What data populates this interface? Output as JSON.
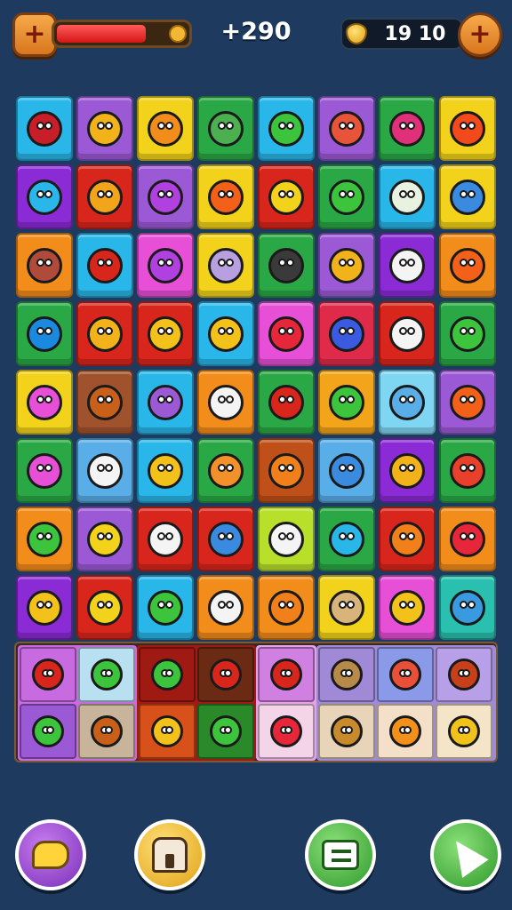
{
  "hud": {
    "health_fraction": 0.82,
    "score": "+290",
    "coins": "19 10",
    "icons": [
      "plus-icon",
      "coin-icon",
      "plus-icon"
    ]
  },
  "board": {
    "rows": 8,
    "cols": 8,
    "tile_colors": [
      [
        "#29b6e8",
        "#9b59d6",
        "#f2d21a",
        "#2aa845",
        "#29b6e8",
        "#9b59d6",
        "#2aa845",
        "#f2d21a"
      ],
      [
        "#8a2bd6",
        "#d8261c",
        "#9b59d6",
        "#f2d21a",
        "#d8261c",
        "#2aa845",
        "#29b6e8",
        "#f2d21a"
      ],
      [
        "#f28c1a",
        "#29b6e8",
        "#e64fd6",
        "#f2d21a",
        "#2aa845",
        "#9b59d6",
        "#8a2bd6",
        "#f28c1a"
      ],
      [
        "#2aa845",
        "#d8261c",
        "#d8261c",
        "#29b6e8",
        "#e64fd6",
        "#e02a4a",
        "#d8261c",
        "#2aa845"
      ],
      [
        "#f2d21a",
        "#a0522d",
        "#29b6e8",
        "#f28c1a",
        "#2aa845",
        "#f2a41a",
        "#7fd6f2",
        "#9b59d6"
      ],
      [
        "#2aa845",
        "#5aaee8",
        "#29b6e8",
        "#2aa845",
        "#c0501a",
        "#5aaee8",
        "#8a2bd6",
        "#2aa845"
      ],
      [
        "#f28c1a",
        "#9b59d6",
        "#d8261c",
        "#d8261c",
        "#b8e02a",
        "#2aa845",
        "#d8261c",
        "#f28c1a"
      ],
      [
        "#8a2bd6",
        "#d8261c",
        "#29b6e8",
        "#f28c1a",
        "#f28c1a",
        "#f2d21a",
        "#e64fd6",
        "#2ac0b0"
      ]
    ],
    "creature_colors": [
      [
        "#c81e2a",
        "#f2b21a",
        "#f28c1a",
        "#4caf50",
        "#3cc43c",
        "#e8543a",
        "#e0307a",
        "#f24a1a"
      ],
      [
        "#29b6e8",
        "#f2a41a",
        "#b040e0",
        "#f2601a",
        "#f2d21a",
        "#3cc43c",
        "#e8f2e0",
        "#3a8ae0"
      ],
      [
        "#b04a3a",
        "#d8261c",
        "#b040e0",
        "#b8a0e0",
        "#3a3a3a",
        "#f2b21a",
        "#f4f4f4",
        "#f2601a"
      ],
      [
        "#1a8ae0",
        "#f2b21a",
        "#f2c21a",
        "#f2c21a",
        "#e8263a",
        "#3a5ae0",
        "#f4f4f4",
        "#3cc43c"
      ],
      [
        "#e64fd6",
        "#c8601a",
        "#9b59d6",
        "#f4f4f4",
        "#d8261c",
        "#3cc43c",
        "#5aaee8",
        "#f2601a"
      ],
      [
        "#e64fd6",
        "#f4f4f4",
        "#f2c21a",
        "#f2902a",
        "#f2801a",
        "#3a8ae0",
        "#f2b21a",
        "#e8402a"
      ],
      [
        "#3cc43c",
        "#f2d21a",
        "#f4f4f4",
        "#3a8ae0",
        "#f4f4f4",
        "#29b6e8",
        "#f2801a",
        "#e8263a"
      ],
      [
        "#f2c21a",
        "#f2d21a",
        "#3cc43c",
        "#f4f4f4",
        "#f2801a",
        "#d8b47a",
        "#f2c21a",
        "#3a9ae0"
      ]
    ]
  },
  "tray": {
    "groups": [
      {
        "bg": "#c86ae0",
        "slots": [
          {
            "bg": "#c86ae0",
            "creature": "#d8261c"
          },
          {
            "bg": "#b8e0f0",
            "creature": "#3cc43c"
          },
          {
            "bg": "#9b59d6",
            "creature": "#3cc43c"
          },
          {
            "bg": "#c8b49a",
            "creature": "#c8601a"
          }
        ]
      },
      {
        "bg": "#a01a14",
        "slots": [
          {
            "bg": "#a01a14",
            "creature": "#3cc43c"
          },
          {
            "bg": "#6a2a14",
            "creature": "#d8261c"
          },
          {
            "bg": "#d8501a",
            "creature": "#f2c21a"
          },
          {
            "bg": "#2a8a2a",
            "creature": "#3cc43c"
          }
        ]
      },
      {
        "bg": "#e8a0e8",
        "slots": [
          {
            "bg": "#d080e0",
            "creature": "#d8261c"
          },
          {
            "bg": "#f4d4e8",
            "creature": "#e8263a"
          }
        ]
      },
      {
        "bg": "#a08ad8",
        "slots": [
          {
            "bg": "#a08ad8",
            "creature": "#b88a4a"
          },
          {
            "bg": "#8a9ae8",
            "creature": "#e8503a"
          },
          {
            "bg": "#b8a0e8",
            "creature": "#c8401a"
          },
          {
            "bg": "#e8d4b8",
            "creature": "#c88a2a"
          },
          {
            "bg": "#f4e0c8",
            "creature": "#f2901a"
          },
          {
            "bg": "#f4e4c8",
            "creature": "#f2c21a"
          }
        ]
      }
    ]
  },
  "buttons": [
    {
      "name": "chat-button",
      "icon": "chat-bubble-icon"
    },
    {
      "name": "shop-button",
      "icon": "shop-icon"
    },
    {
      "name": "menu-button",
      "icon": "menu-icon"
    },
    {
      "name": "play-button",
      "icon": "arrow-icon"
    }
  ]
}
